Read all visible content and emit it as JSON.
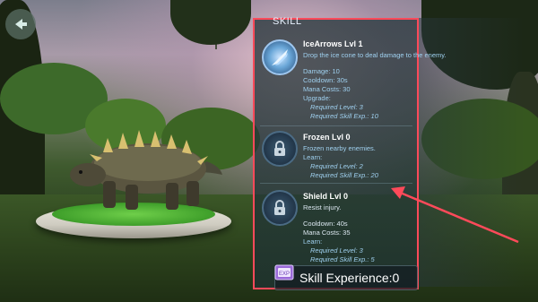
{
  "panel": {
    "title": "SKILL",
    "skills": [
      {
        "name": "IceArrows Lvl 1",
        "description": "Drop the ice cone to deal damage to the enemy.",
        "damage": "Damage: 10",
        "cooldown": "Cooldown: 30s",
        "mana": "Mana Costs: 30",
        "learn": "Upgrade:",
        "req_level": "Required Level: 3",
        "req_exp": "Required Skill Exp.: 10",
        "icon": "ice-arrows-icon"
      },
      {
        "name": "Frozen Lvl 0",
        "description": "Frozen nearby enemies.",
        "learn": "Learn:",
        "req_level": "Required Level: 2",
        "req_exp": "Required Skill Exp.: 20",
        "icon": "lock-icon"
      },
      {
        "name": "Shield Lvl 0",
        "description": "Resist injury.",
        "cooldown": "Cooldown: 40s",
        "mana": "Mana Costs: 35",
        "learn": "Learn:",
        "req_level": "Required Level: 3",
        "req_exp": "Required Skill Exp.: 5",
        "icon": "lock-icon"
      }
    ]
  },
  "experience": {
    "label": "Skill Experience:0"
  },
  "colors": {
    "highlight": "#ff4a5a",
    "accent_text": "#9fd0ef"
  }
}
